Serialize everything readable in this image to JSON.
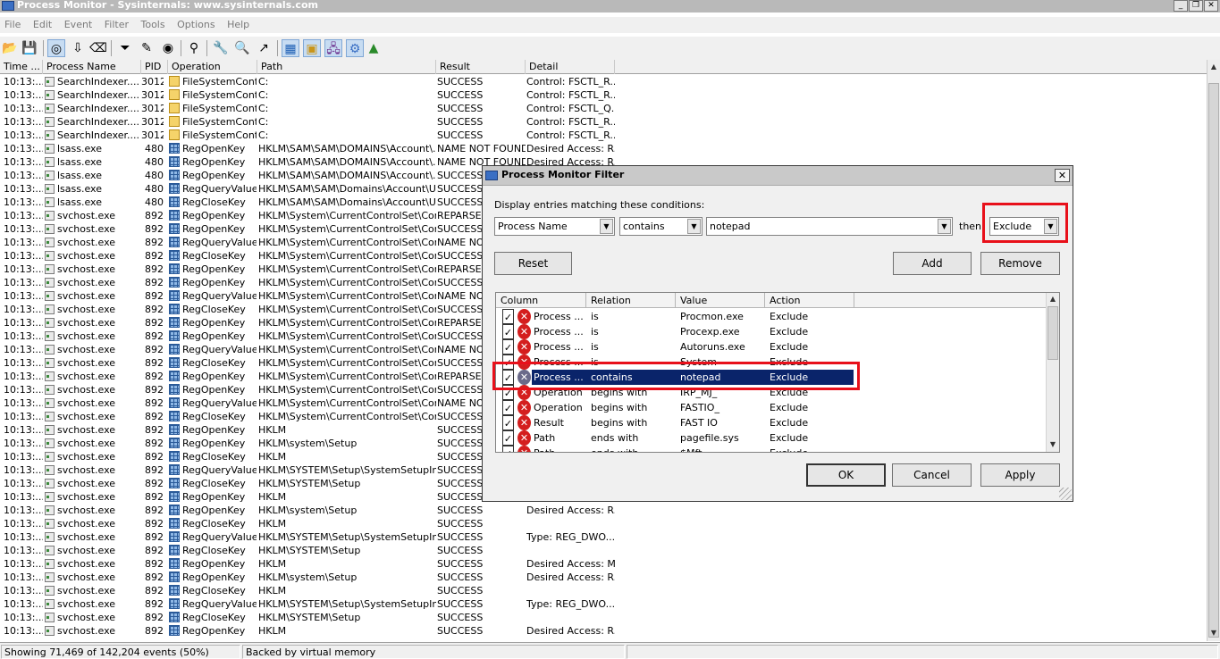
{
  "window": {
    "title": "Process Monitor - Sysinternals: www.sysinternals.com"
  },
  "menu": [
    "File",
    "Edit",
    "Event",
    "Filter",
    "Tools",
    "Options",
    "Help"
  ],
  "toolbar": {
    "icons": [
      "open-icon",
      "save-icon",
      "capture-icon",
      "autoscroll-icon",
      "clear-icon",
      "filter-icon",
      "highlight-icon",
      "include-process-icon",
      "process-tree-icon",
      "find-icon",
      "jump-icon",
      "registry-activity-icon",
      "file-activity-icon",
      "network-activity-icon",
      "process-activity-icon",
      "profiling-icon"
    ]
  },
  "grid": {
    "columns": [
      "Time ...",
      "Process Name",
      "PID",
      "Operation",
      "Path",
      "Result",
      "Detail"
    ],
    "rows": [
      [
        "10:13:...",
        "SearchIndexer....",
        "3012",
        "fs",
        "FileSystemControl",
        "C:",
        "SUCCESS",
        "Control: FSCTL_R..."
      ],
      [
        "10:13:...",
        "SearchIndexer....",
        "3012",
        "fs",
        "FileSystemControl",
        "C:",
        "SUCCESS",
        "Control: FSCTL_R..."
      ],
      [
        "10:13:...",
        "SearchIndexer....",
        "3012",
        "fs",
        "FileSystemControl",
        "C:",
        "SUCCESS",
        "Control: FSCTL_Q..."
      ],
      [
        "10:13:...",
        "SearchIndexer....",
        "3012",
        "fs",
        "FileSystemControl",
        "C:",
        "SUCCESS",
        "Control: FSCTL_R..."
      ],
      [
        "10:13:...",
        "SearchIndexer....",
        "3012",
        "fs",
        "FileSystemControl",
        "C:",
        "SUCCESS",
        "Control: FSCTL_R..."
      ],
      [
        "10:13:...",
        "lsass.exe",
        "480",
        "reg",
        "RegOpenKey",
        "HKLM\\SAM\\SAM\\DOMAINS\\Account\\...",
        "NAME NOT FOUND",
        "Desired Access: R..."
      ],
      [
        "10:13:...",
        "lsass.exe",
        "480",
        "reg",
        "RegOpenKey",
        "HKLM\\SAM\\SAM\\DOMAINS\\Account\\...",
        "NAME NOT FOUND",
        "Desired Access: R..."
      ],
      [
        "10:13:...",
        "lsass.exe",
        "480",
        "reg",
        "RegOpenKey",
        "HKLM\\SAM\\SAM\\DOMAINS\\Account\\...",
        "SUCCESS",
        ""
      ],
      [
        "10:13:...",
        "lsass.exe",
        "480",
        "reg",
        "RegQueryValue",
        "HKLM\\SAM\\SAM\\Domains\\Account\\U...",
        "SUCCESS",
        ""
      ],
      [
        "10:13:...",
        "lsass.exe",
        "480",
        "reg",
        "RegCloseKey",
        "HKLM\\SAM\\SAM\\Domains\\Account\\U...",
        "SUCCESS",
        ""
      ],
      [
        "10:13:...",
        "svchost.exe",
        "892",
        "reg",
        "RegOpenKey",
        "HKLM\\System\\CurrentControlSet\\Contr...",
        "REPARSE",
        ""
      ],
      [
        "10:13:...",
        "svchost.exe",
        "892",
        "reg",
        "RegOpenKey",
        "HKLM\\System\\CurrentControlSet\\Contr...",
        "SUCCESS",
        ""
      ],
      [
        "10:13:...",
        "svchost.exe",
        "892",
        "reg",
        "RegQueryValue",
        "HKLM\\System\\CurrentControlSet\\Contr...",
        "NAME NO",
        ""
      ],
      [
        "10:13:...",
        "svchost.exe",
        "892",
        "reg",
        "RegCloseKey",
        "HKLM\\System\\CurrentControlSet\\Contr...",
        "SUCCESS",
        ""
      ],
      [
        "10:13:...",
        "svchost.exe",
        "892",
        "reg",
        "RegOpenKey",
        "HKLM\\System\\CurrentControlSet\\Contr...",
        "REPARSE",
        ""
      ],
      [
        "10:13:...",
        "svchost.exe",
        "892",
        "reg",
        "RegOpenKey",
        "HKLM\\System\\CurrentControlSet\\Contr...",
        "SUCCESS",
        ""
      ],
      [
        "10:13:...",
        "svchost.exe",
        "892",
        "reg",
        "RegQueryValue",
        "HKLM\\System\\CurrentControlSet\\Contr...",
        "NAME NO",
        ""
      ],
      [
        "10:13:...",
        "svchost.exe",
        "892",
        "reg",
        "RegCloseKey",
        "HKLM\\System\\CurrentControlSet\\Contr...",
        "SUCCESS",
        ""
      ],
      [
        "10:13:...",
        "svchost.exe",
        "892",
        "reg",
        "RegOpenKey",
        "HKLM\\System\\CurrentControlSet\\Contr...",
        "REPARSE",
        ""
      ],
      [
        "10:13:...",
        "svchost.exe",
        "892",
        "reg",
        "RegOpenKey",
        "HKLM\\System\\CurrentControlSet\\Contr...",
        "SUCCESS",
        ""
      ],
      [
        "10:13:...",
        "svchost.exe",
        "892",
        "reg",
        "RegQueryValue",
        "HKLM\\System\\CurrentControlSet\\Contr...",
        "NAME NO",
        ""
      ],
      [
        "10:13:...",
        "svchost.exe",
        "892",
        "reg",
        "RegCloseKey",
        "HKLM\\System\\CurrentControlSet\\Contr...",
        "SUCCESS",
        ""
      ],
      [
        "10:13:...",
        "svchost.exe",
        "892",
        "reg",
        "RegOpenKey",
        "HKLM\\System\\CurrentControlSet\\Contr...",
        "REPARSE",
        ""
      ],
      [
        "10:13:...",
        "svchost.exe",
        "892",
        "reg",
        "RegOpenKey",
        "HKLM\\System\\CurrentControlSet\\Contr...",
        "SUCCESS",
        ""
      ],
      [
        "10:13:...",
        "svchost.exe",
        "892",
        "reg",
        "RegQueryValue",
        "HKLM\\System\\CurrentControlSet\\Contr...",
        "NAME NO",
        ""
      ],
      [
        "10:13:...",
        "svchost.exe",
        "892",
        "reg",
        "RegCloseKey",
        "HKLM\\System\\CurrentControlSet\\Contr...",
        "SUCCESS",
        ""
      ],
      [
        "10:13:...",
        "svchost.exe",
        "892",
        "reg",
        "RegOpenKey",
        "HKLM",
        "SUCCESS",
        ""
      ],
      [
        "10:13:...",
        "svchost.exe",
        "892",
        "reg",
        "RegOpenKey",
        "HKLM\\system\\Setup",
        "SUCCESS",
        ""
      ],
      [
        "10:13:...",
        "svchost.exe",
        "892",
        "reg",
        "RegCloseKey",
        "HKLM",
        "SUCCESS",
        ""
      ],
      [
        "10:13:...",
        "svchost.exe",
        "892",
        "reg",
        "RegQueryValue",
        "HKLM\\SYSTEM\\Setup\\SystemSetupIn...",
        "SUCCESS",
        ""
      ],
      [
        "10:13:...",
        "svchost.exe",
        "892",
        "reg",
        "RegCloseKey",
        "HKLM\\SYSTEM\\Setup",
        "SUCCESS",
        ""
      ],
      [
        "10:13:...",
        "svchost.exe",
        "892",
        "reg",
        "RegOpenKey",
        "HKLM",
        "SUCCESS",
        ""
      ],
      [
        "10:13:...",
        "svchost.exe",
        "892",
        "reg",
        "RegOpenKey",
        "HKLM\\system\\Setup",
        "SUCCESS",
        "Desired Access: R..."
      ],
      [
        "10:13:...",
        "svchost.exe",
        "892",
        "reg",
        "RegCloseKey",
        "HKLM",
        "SUCCESS",
        ""
      ],
      [
        "10:13:...",
        "svchost.exe",
        "892",
        "reg",
        "RegQueryValue",
        "HKLM\\SYSTEM\\Setup\\SystemSetupIn...",
        "SUCCESS",
        "Type: REG_DWO..."
      ],
      [
        "10:13:...",
        "svchost.exe",
        "892",
        "reg",
        "RegCloseKey",
        "HKLM\\SYSTEM\\Setup",
        "SUCCESS",
        ""
      ],
      [
        "10:13:...",
        "svchost.exe",
        "892",
        "reg",
        "RegOpenKey",
        "HKLM",
        "SUCCESS",
        "Desired Access: M..."
      ],
      [
        "10:13:...",
        "svchost.exe",
        "892",
        "reg",
        "RegOpenKey",
        "HKLM\\system\\Setup",
        "SUCCESS",
        "Desired Access: R..."
      ],
      [
        "10:13:...",
        "svchost.exe",
        "892",
        "reg",
        "RegCloseKey",
        "HKLM",
        "SUCCESS",
        ""
      ],
      [
        "10:13:...",
        "svchost.exe",
        "892",
        "reg",
        "RegQueryValue",
        "HKLM\\SYSTEM\\Setup\\SystemSetupIn...",
        "SUCCESS",
        "Type: REG_DWO..."
      ],
      [
        "10:13:...",
        "svchost.exe",
        "892",
        "reg",
        "RegCloseKey",
        "HKLM\\SYSTEM\\Setup",
        "SUCCESS",
        ""
      ],
      [
        "10:13:...",
        "svchost.exe",
        "892",
        "reg",
        "RegOpenKey",
        "HKLM",
        "SUCCESS",
        "Desired Access: R..."
      ]
    ]
  },
  "status": {
    "events": "Showing 71,469 of 142,204 events (50%)",
    "memory": "Backed by virtual memory"
  },
  "filter_dialog": {
    "title": "Process Monitor Filter",
    "prompt": "Display entries matching these conditions:",
    "column_value": "Process Name",
    "relation_value": "contains",
    "value_input": "notepad",
    "then_label": "then",
    "action_value": "Exclude",
    "buttons": {
      "reset": "Reset",
      "add": "Add",
      "remove": "Remove",
      "ok": "OK",
      "cancel": "Cancel",
      "apply": "Apply"
    },
    "list_headers": [
      "Column",
      "Relation",
      "Value",
      "Action"
    ],
    "list_rows": [
      [
        "Process ...",
        "is",
        "Procmon.exe",
        "Exclude"
      ],
      [
        "Process ...",
        "is",
        "Procexp.exe",
        "Exclude"
      ],
      [
        "Process ...",
        "is",
        "Autoruns.exe",
        "Exclude"
      ],
      [
        "Process ...",
        "is",
        "System",
        "Exclude"
      ],
      [
        "Process ...",
        "contains",
        "notepad",
        "Exclude"
      ],
      [
        "Operation",
        "begins with",
        "IRP_MJ_",
        "Exclude"
      ],
      [
        "Operation",
        "begins with",
        "FASTIO_",
        "Exclude"
      ],
      [
        "Result",
        "begins with",
        "FAST IO",
        "Exclude"
      ],
      [
        "Path",
        "ends with",
        "pagefile.sys",
        "Exclude"
      ],
      [
        "Path",
        "ends with",
        "$Mft",
        "Exclude"
      ]
    ],
    "selected_row": 4,
    "highlight_color": "#e8101a",
    "selection_color": "#0a246a"
  }
}
